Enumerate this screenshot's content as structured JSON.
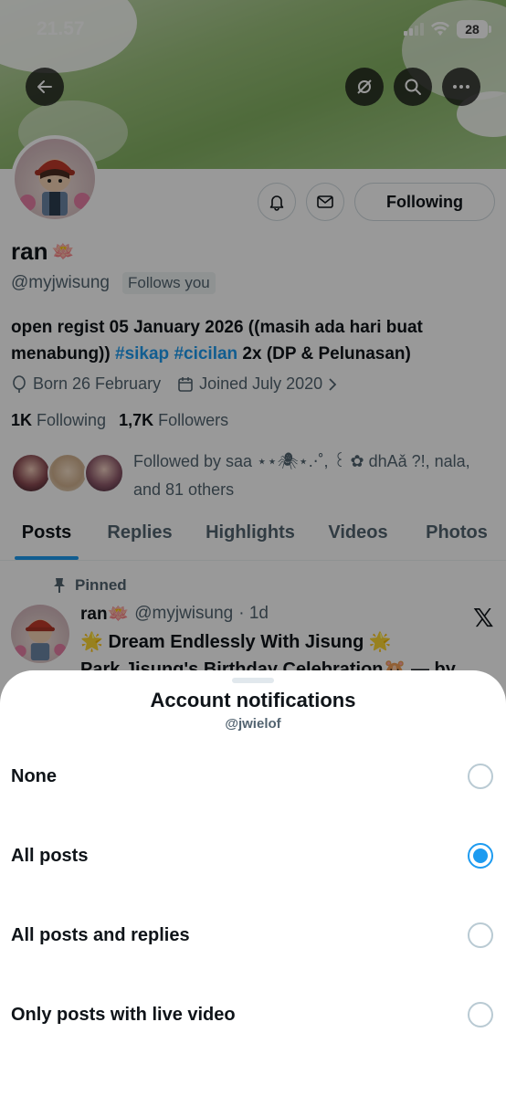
{
  "status_bar": {
    "time": "21.57",
    "battery": "28"
  },
  "profile": {
    "name": "ran",
    "name_emoji": "🪷",
    "handle": "@myjwisung",
    "follows_you": "Follows you",
    "follow_button": "Following",
    "bio_text_1": "open regist 05 January 2026 ((masih ada hari buat menabung)) ",
    "bio_hashtag_1": "#sikap",
    "bio_hashtag_2": "#cicilan",
    "bio_text_2": " 2x (DP & Pelunasan)",
    "born": "Born 26 February",
    "joined": "Joined July 2020",
    "following_count": "1K",
    "following_label": "Following",
    "followers_count": "1,7K",
    "followers_label": "Followers",
    "followed_by": "Followed by saa ⋆⋆🕷⋆.⋅˚, ꒰ ✿ dhAǎ ?!, nala, and 81 others"
  },
  "tabs": [
    "Posts",
    "Replies",
    "Highlights",
    "Videos",
    "Photos"
  ],
  "pinned_post": {
    "pinned_label": "Pinned",
    "author": "ran🪷",
    "handle": "@myjwisung",
    "time": "· 1d",
    "line1": "🌟 Dream Endlessly With Jisung 🌟",
    "line2": "Park Jisung's Birthday Celebration🐹 — by"
  },
  "sheet": {
    "title": "Account notifications",
    "subtitle": "@jwielof",
    "options": [
      {
        "label": "None",
        "selected": false
      },
      {
        "label": "All posts",
        "selected": true
      },
      {
        "label": "All posts and replies",
        "selected": false
      },
      {
        "label": "Only posts with live video",
        "selected": false
      }
    ]
  },
  "colors": {
    "accent": "#1d9bf0",
    "text": "#0f1419",
    "secondary": "#536471"
  }
}
